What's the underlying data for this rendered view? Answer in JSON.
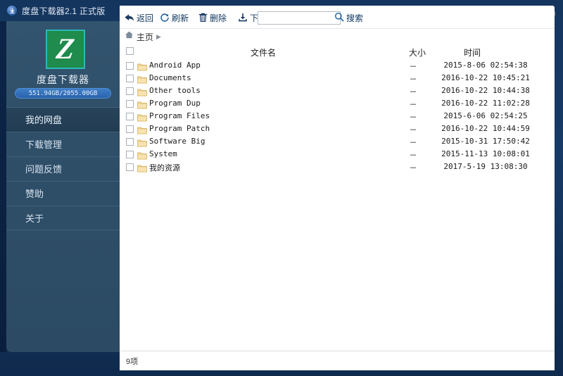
{
  "window": {
    "title": "度盘下载器2.1 正式版",
    "title_icon": "download-circle-icon",
    "controls": [
      {
        "name": "logout-button",
        "icon": "logout-icon"
      },
      {
        "name": "minimize-button",
        "icon": "minimize-icon"
      },
      {
        "name": "close-button",
        "icon": "close-icon"
      }
    ]
  },
  "sidebar": {
    "logo_letter": "Z",
    "app_name": "度盘下载器",
    "storage": "551.94GB/2055.00GB",
    "items": [
      {
        "label": "我的网盘",
        "active": true
      },
      {
        "label": "下载管理",
        "active": false
      },
      {
        "label": "问题反馈",
        "active": false
      },
      {
        "label": "赞助",
        "active": false
      },
      {
        "label": "关于",
        "active": false
      }
    ]
  },
  "toolbar": {
    "back_label": "返回",
    "refresh_label": "刷新",
    "delete_label": "删除",
    "download_label": "下载",
    "search_label": "搜索",
    "search_value": "",
    "search_placeholder": ""
  },
  "breadcrumb": {
    "home_label": "主页",
    "separator": "▶"
  },
  "table": {
    "headers": {
      "name": "文件名",
      "size": "大小",
      "time": "时间"
    },
    "rows": [
      {
        "name": "Android App",
        "size": "－",
        "time": "2015-8-06 02:54:38"
      },
      {
        "name": "Documents",
        "size": "－",
        "time": "2016-10-22 10:45:21"
      },
      {
        "name": "Other tools",
        "size": "－",
        "time": "2016-10-22 10:44:38"
      },
      {
        "name": "Program Dup",
        "size": "－",
        "time": "2016-10-22 11:02:28"
      },
      {
        "name": "Program Files",
        "size": "－",
        "time": "2015-6-06 02:54:25"
      },
      {
        "name": "Program Patch",
        "size": "－",
        "time": "2016-10-22 10:44:59"
      },
      {
        "name": "Software Big",
        "size": "－",
        "time": "2015-10-31 17:50:42"
      },
      {
        "name": "System",
        "size": "－",
        "time": "2015-11-13 10:08:01"
      },
      {
        "name": "我的资源",
        "size": "－",
        "time": "2017-5-19 13:08:30"
      }
    ]
  },
  "statusbar": {
    "count_label": "9项"
  },
  "colors": {
    "accent": "#1f8b4c",
    "logo_border": "#2fb7b7",
    "sidebar": "#2f4f69",
    "frame": "#14355e",
    "toolbar_text": "#11375f",
    "folder": "#f6dfa8"
  }
}
